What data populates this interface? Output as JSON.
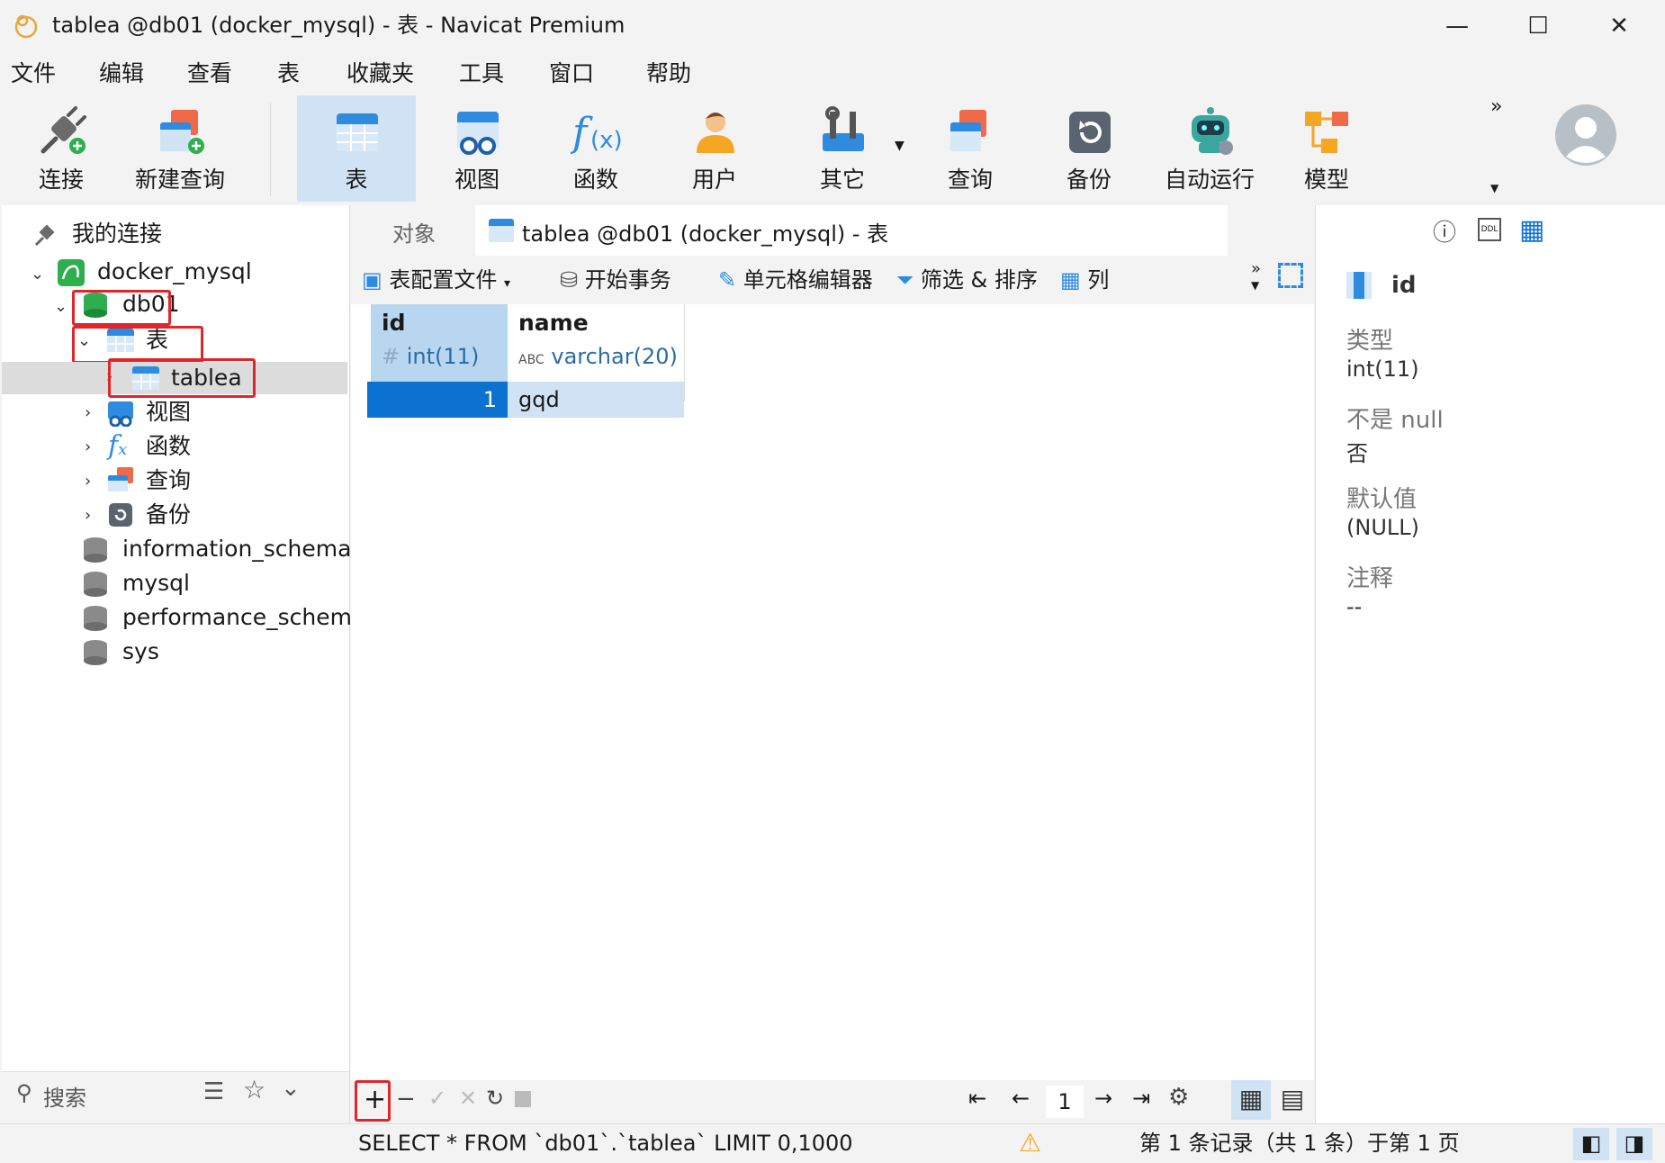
{
  "window": {
    "title": "tablea @db01 (docker_mysql) - 表 - Navicat Premium",
    "minimize_glyph": "—",
    "maximize_glyph": "☐",
    "close_glyph": "✕"
  },
  "menu": [
    "文件",
    "编辑",
    "查看",
    "表",
    "收藏夹",
    "工具",
    "窗口",
    "帮助"
  ],
  "toolbar": {
    "items": [
      {
        "label": "连接",
        "icon": "plug-icon"
      },
      {
        "label": "新建查询",
        "icon": "new-query-icon"
      },
      {
        "label": "表",
        "icon": "table-icon",
        "active": true
      },
      {
        "label": "视图",
        "icon": "view-icon"
      },
      {
        "label": "函数",
        "icon": "function-icon"
      },
      {
        "label": "用户",
        "icon": "user-icon"
      },
      {
        "label": "其它",
        "icon": "tools-icon"
      },
      {
        "label": "查询",
        "icon": "query-icon"
      },
      {
        "label": "备份",
        "icon": "backup-icon"
      },
      {
        "label": "自动运行",
        "icon": "robot-icon"
      },
      {
        "label": "模型",
        "icon": "model-icon"
      }
    ],
    "more_glyph": "»"
  },
  "tree": {
    "root_label": "我的连接",
    "connection": "docker_mysql",
    "database": "db01",
    "tables_folder": "表",
    "table": "tablea",
    "folders": [
      "视图",
      "函数",
      "查询",
      "备份"
    ],
    "other_databases": [
      "information_schema",
      "mysql",
      "performance_schema",
      "sys"
    ]
  },
  "search": {
    "placeholder": "搜索"
  },
  "tabs": {
    "objects": "对象",
    "active": "tablea @db01 (docker_mysql) - 表"
  },
  "subtoolbar": {
    "profile": "表配置文件",
    "begin_tx": "开始事务",
    "cell_editor": "单元格编辑器",
    "filter_sort": "筛选 & 排序",
    "columns": "列"
  },
  "grid": {
    "columns": [
      {
        "name": "id",
        "type": "int(11)",
        "type_glyph": "#"
      },
      {
        "name": "name",
        "type": "varchar(20)",
        "type_glyph": "ABC"
      }
    ],
    "rows": [
      {
        "id": "1",
        "name": "gqd"
      }
    ]
  },
  "pager": {
    "page": "1"
  },
  "status": {
    "sql": "SELECT * FROM `db01`.`tablea` LIMIT 0,1000",
    "records": "第 1 条记录（共 1 条）于第 1 页"
  },
  "properties": {
    "field": "id",
    "type_label": "类型",
    "type_value": "int(11)",
    "notnull_label": "不是 null",
    "notnull_value": "否",
    "default_label": "默认值",
    "default_value": "(NULL)",
    "comment_label": "注释",
    "comment_value": "--"
  },
  "colors": {
    "accent": "#0b72d2",
    "selection": "#cfe3f5",
    "highlight": "#e0262b"
  }
}
